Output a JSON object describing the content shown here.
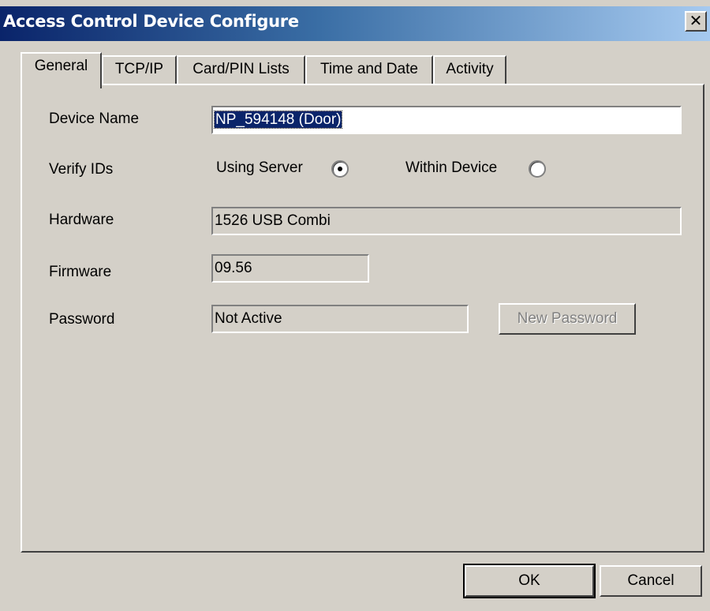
{
  "window": {
    "title": "Access Control Device Configure",
    "close_glyph": "✕",
    "close_icon": "close-icon"
  },
  "tabs": [
    {
      "label": "General",
      "active": true
    },
    {
      "label": "TCP/IP",
      "active": false
    },
    {
      "label": "Card/PIN Lists",
      "active": false
    },
    {
      "label": "Time and Date",
      "active": false
    },
    {
      "label": "Activity",
      "active": false
    }
  ],
  "general": {
    "device_name_label": "Device Name",
    "device_name_value": "NP_594148 (Door)",
    "verify_ids_label": "Verify IDs",
    "using_server_label": "Using Server",
    "using_server_selected": true,
    "within_device_label": "Within Device",
    "within_device_selected": false,
    "hardware_label": "Hardware",
    "hardware_value": "1526 USB Combi",
    "firmware_label": "Firmware",
    "firmware_value": "09.56",
    "password_label": "Password",
    "password_value": "Not Active",
    "new_password_button": "New Password"
  },
  "buttons": {
    "ok": "OK",
    "cancel": "Cancel"
  },
  "colors": {
    "title_bar_start": "#0a246a",
    "title_bar_end": "#a6caf0",
    "face": "#d4d0c8",
    "selection": "#0a246a"
  }
}
